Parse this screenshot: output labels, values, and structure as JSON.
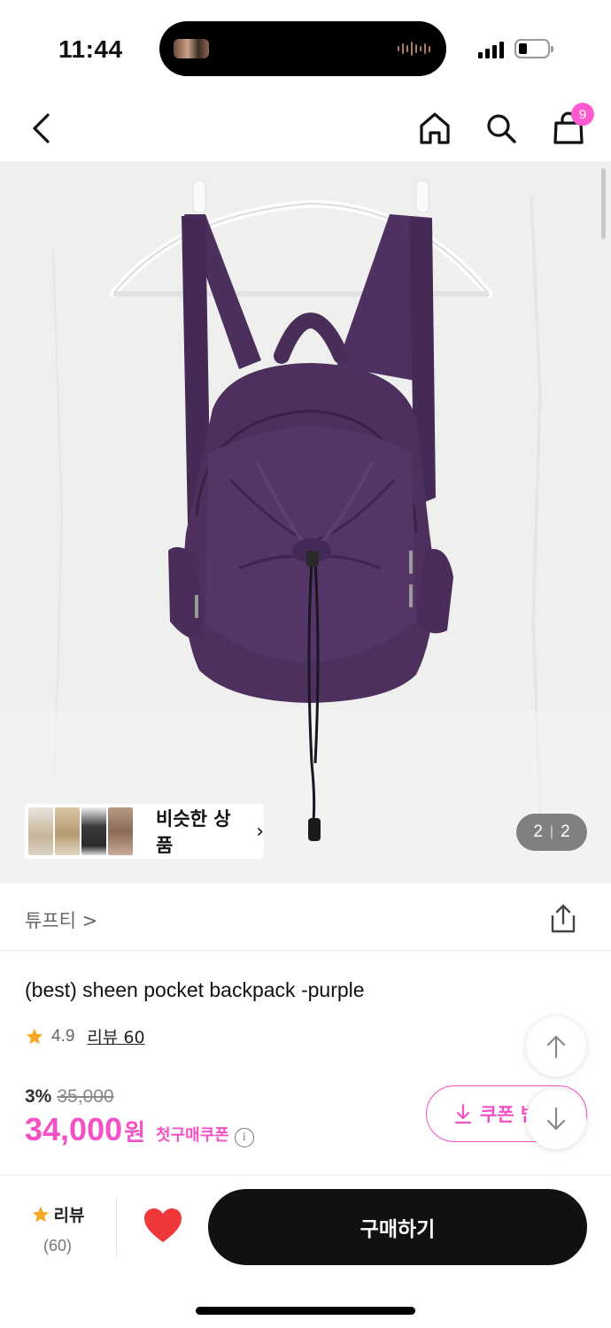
{
  "status_bar": {
    "time": "11:44"
  },
  "header": {
    "cart_count": "9"
  },
  "gallery": {
    "similar_label": "비슷한 상품",
    "chevron": "›",
    "pager_current": "2",
    "pager_sep": "|",
    "pager_total": "2"
  },
  "brand": {
    "name": "튜프티 >"
  },
  "product": {
    "title": "(best) sheen pocket backpack -purple",
    "rating": "4.9",
    "review_link": "리뷰 60",
    "discount_pct": "3%",
    "original_price": "35,000",
    "price": "34,000",
    "currency": "원",
    "first_purchase_coupon": "첫구매쿠폰",
    "info_icon_glyph": "i",
    "coupon_button": "쿠폰 받"
  },
  "bottom_bar": {
    "review_label": "리뷰",
    "review_count": "(60)",
    "buy_label": "구매하기"
  },
  "icons": {
    "back": "back-icon",
    "home": "home-icon",
    "search": "search-icon",
    "cart": "cart-icon",
    "share": "share-icon",
    "star": "star-icon",
    "heart": "heart-icon",
    "arrow_up": "arrow-up-icon",
    "arrow_down": "arrow-down-icon",
    "download": "download-icon"
  },
  "colors": {
    "accent_pink": "#f451c6",
    "badge_pink": "#ff5bd0",
    "heart_red": "#f0383a",
    "star_orange": "#f5a623",
    "backpack_purple": "#4b2f5c"
  }
}
